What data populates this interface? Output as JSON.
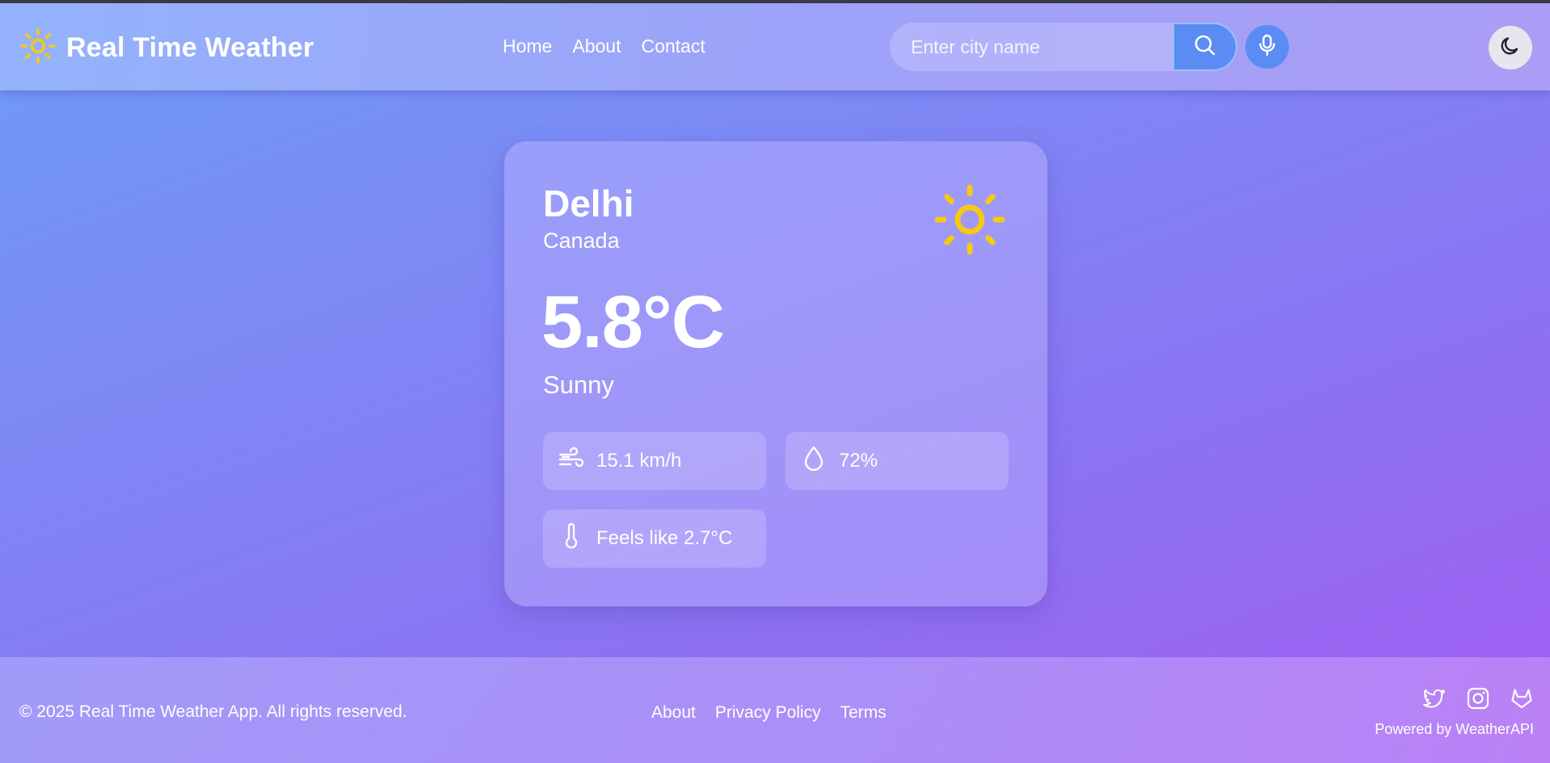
{
  "header": {
    "title": "Real Time Weather",
    "logo_icon": "sun-icon",
    "nav": [
      "Home",
      "About",
      "Contact"
    ],
    "search": {
      "placeholder": "Enter city name",
      "value": ""
    },
    "search_icon": "search-icon",
    "mic_icon": "microphone-icon",
    "theme_icon": "moon-icon"
  },
  "weather": {
    "city": "Delhi",
    "country": "Canada",
    "condition_icon": "sun-icon",
    "temperature": "5.8°C",
    "condition": "Sunny",
    "wind": {
      "icon": "wind-icon",
      "value": "15.1 km/h"
    },
    "humidity": {
      "icon": "droplet-icon",
      "value": "72%"
    },
    "feels_like": {
      "icon": "thermometer-icon",
      "value": "Feels like 2.7°C"
    }
  },
  "footer": {
    "copyright": "© 2025 Real Time Weather App. All rights reserved.",
    "links": [
      "About",
      "Privacy Policy",
      "Terms"
    ],
    "social_icons": [
      "twitter-icon",
      "instagram-icon",
      "gitlab-icon"
    ],
    "powered_by": "Powered by WeatherAPI"
  },
  "colors": {
    "sun": "#f6c915",
    "accent_blue": "#5b8cf3",
    "gradient_start": "#6d9cf8",
    "gradient_end": "#a35cf1"
  }
}
